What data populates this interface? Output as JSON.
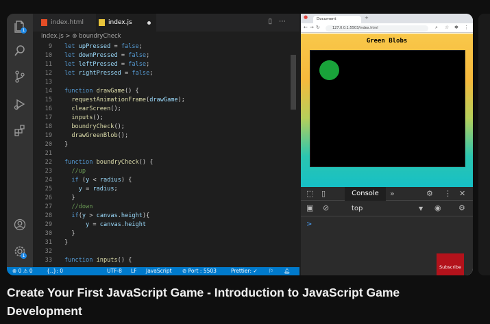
{
  "editor": {
    "tabs": [
      {
        "label": "index.html",
        "active": false
      },
      {
        "label": "index.js",
        "active": true
      }
    ],
    "breadcrumb": {
      "file": "index.js",
      "separator": ">",
      "symbol": "boundryCheck"
    },
    "activity_badges": [
      "1",
      "1"
    ],
    "code_lines": [
      {
        "n": "9",
        "text": "let upPressed = false;"
      },
      {
        "n": "10",
        "text": "let downPressed = false;"
      },
      {
        "n": "11",
        "text": "let leftPressed = false;"
      },
      {
        "n": "12",
        "text": "let rightPressed = false;"
      },
      {
        "n": "13",
        "text": ""
      },
      {
        "n": "14",
        "text": "function drawGame() {"
      },
      {
        "n": "15",
        "text": "  requestAnimationFrame(drawGame);"
      },
      {
        "n": "16",
        "text": "  clearScreen();"
      },
      {
        "n": "17",
        "text": "  inputs();"
      },
      {
        "n": "18",
        "text": "  boundryCheck();"
      },
      {
        "n": "19",
        "text": "  drawGreenBlob();"
      },
      {
        "n": "20",
        "text": "}"
      },
      {
        "n": "21",
        "text": ""
      },
      {
        "n": "22",
        "text": "function boundryCheck() {"
      },
      {
        "n": "23",
        "text": "  //up"
      },
      {
        "n": "24",
        "text": "  if (y < radius) {"
      },
      {
        "n": "25",
        "text": "    y = radius;"
      },
      {
        "n": "26",
        "text": "  }"
      },
      {
        "n": "27",
        "text": "  //down"
      },
      {
        "n": "28",
        "text": "  if(y > canvas.height){"
      },
      {
        "n": "29",
        "text": "      y = canvas.height"
      },
      {
        "n": "30",
        "text": "  }"
      },
      {
        "n": "31",
        "text": "}"
      },
      {
        "n": "32",
        "text": ""
      },
      {
        "n": "33",
        "text": "function inputs() {"
      }
    ],
    "status": {
      "problems": "⊗ 0 ⚠ 0",
      "braces": "{..}: 0",
      "encoding": "UTF-8",
      "eol": "LF",
      "language": "JavaScript",
      "port": "⊘ Port : 5503",
      "prettier": "Prettier: ✓"
    }
  },
  "browser": {
    "tab_title": "Document",
    "address": "127.0.0.1:5503/index.html",
    "game_title": "Green Blobs",
    "devtools": {
      "active_tab": "Console",
      "context": "top",
      "prompt": ">"
    },
    "subscribe_label": "Subscribe"
  },
  "video": {
    "title": "Create Your First JavaScript Game - Introduction to JavaScript Game Development"
  },
  "colors": {
    "keyword": "#569cd6",
    "function": "#dcdcaa",
    "variable": "#9cdcfe",
    "comment": "#6a9955",
    "statusbar": "#007acc",
    "blob": "#19a33a",
    "subscribe": "#b3121b"
  },
  "icons": [
    "explorer-icon",
    "search-icon",
    "source-control-icon",
    "run-debug-icon",
    "extensions-icon",
    "account-icon",
    "settings-icon"
  ]
}
